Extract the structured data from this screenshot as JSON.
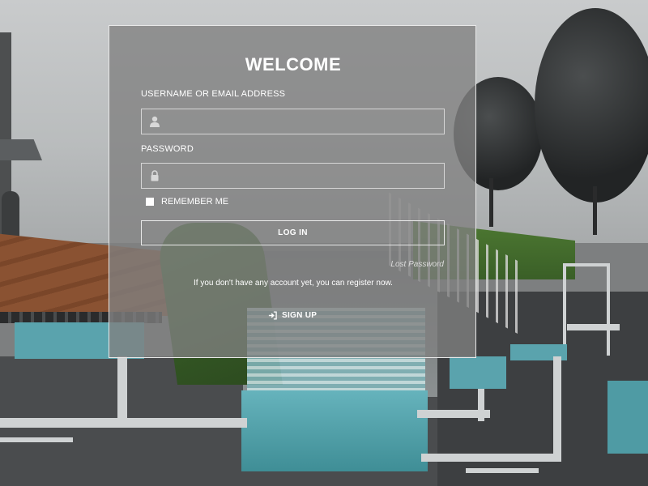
{
  "panel": {
    "title": "WELCOME",
    "username": {
      "label": "USERNAME OR EMAIL ADDRESS",
      "value": "",
      "placeholder": "",
      "icon": "user-icon"
    },
    "password": {
      "label": "PASSWORD",
      "value": "",
      "placeholder": "",
      "icon": "lock-icon"
    },
    "remember_label": "REMEMBER ME",
    "login_label": "LOG IN",
    "lost_password_label": "Lost Password",
    "register_note": "If you don't have any account yet, you can register now.",
    "signup_label": "SIGN UP",
    "signup_icon": "sign-in-icon"
  },
  "colors": {
    "panel_border": "#e9e9e9",
    "text": "#ffffff",
    "panel_fill": "rgba(128,128,128,0.78)"
  }
}
